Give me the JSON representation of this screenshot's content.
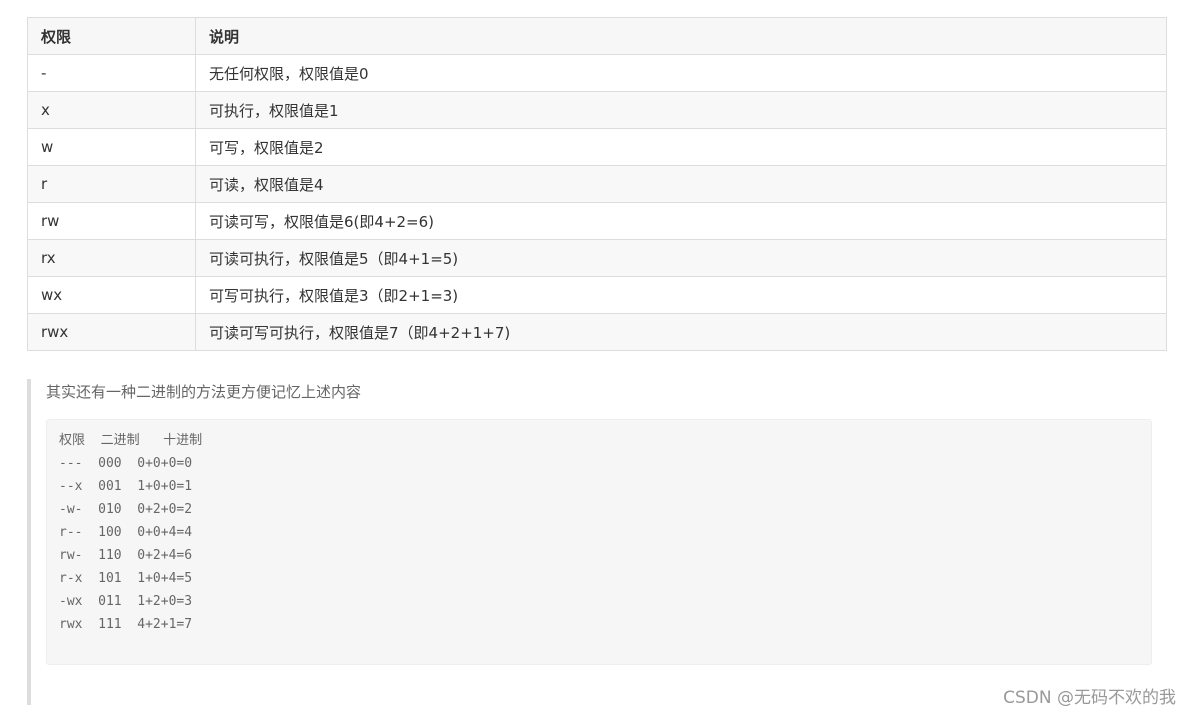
{
  "table": {
    "headers": [
      "权限",
      "说明"
    ],
    "rows": [
      [
        "-",
        "无任何权限，权限值是0"
      ],
      [
        "x",
        "可执行，权限值是1"
      ],
      [
        "w",
        "可写，权限值是2"
      ],
      [
        "r",
        "可读，权限值是4"
      ],
      [
        "rw",
        "可读可写，权限值是6(即4+2=6)"
      ],
      [
        "rx",
        "可读可执行，权限值是5（即4+1=5)"
      ],
      [
        "wx",
        "可写可执行，权限值是3（即2+1=3)"
      ],
      [
        "rwx",
        "可读可写可执行，权限值是7（即4+2+1+7)"
      ]
    ]
  },
  "quote": {
    "text": "其实还有一种二进制的方法更方便记忆上述内容"
  },
  "code": {
    "lines": [
      "权限  二进制   十进制",
      "---  000  0+0+0=0",
      "--x  001  1+0+0=1",
      "-w-  010  0+2+0=2",
      "r--  100  0+0+4=4",
      "rw-  110  0+2+4=6",
      "r-x  101  1+0+4=5",
      "-wx  011  1+2+0=3",
      "rwx  111  4+2+1=7"
    ]
  },
  "watermark": "CSDN @无码不欢的我"
}
